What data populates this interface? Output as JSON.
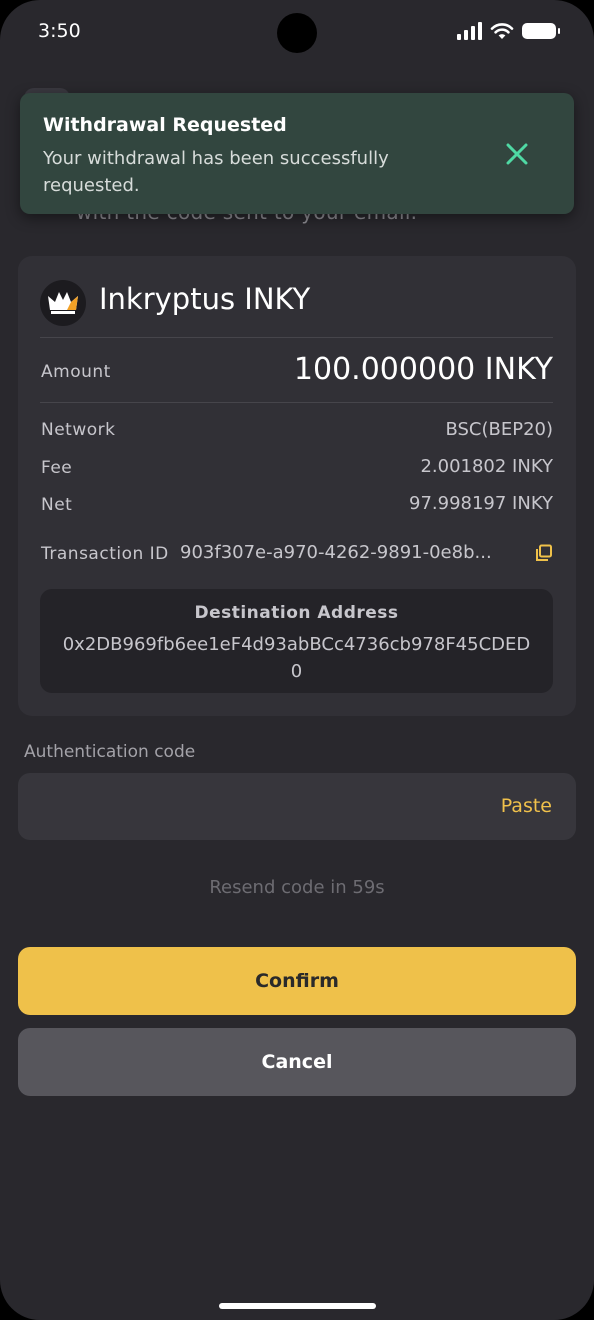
{
  "status_bar": {
    "time": "3:50"
  },
  "background": {
    "subtitle": "with the code sent to your email."
  },
  "toast": {
    "title": "Withdrawal Requested",
    "message": "Your withdrawal has been successfully requested.",
    "accent_color": "#4fd9a4"
  },
  "token": {
    "name": "Inkryptus INKY",
    "icon": "crown-logo-icon"
  },
  "details": {
    "amount_label": "Amount",
    "amount_value": "100.000000 INKY",
    "network_label": "Network",
    "network_value": "BSC(BEP20)",
    "fee_label": "Fee",
    "fee_value": "2.001802 INKY",
    "net_label": "Net",
    "net_value": "97.998197 INKY",
    "txid_label": "Transaction ID",
    "txid_value": "903f307e-a970-4262-9891-0e8b...",
    "destination_title": "Destination Address",
    "destination_address": "0x2DB969fb6ee1eF4d93abBCc4736cb978F45CDED0"
  },
  "auth": {
    "label": "Authentication code",
    "placeholder": "",
    "paste_label": "Paste",
    "resend_text": "Resend code in 59s"
  },
  "buttons": {
    "confirm": "Confirm",
    "cancel": "Cancel"
  },
  "colors": {
    "primary": "#efc14a",
    "background": "#29282d",
    "toast_bg": "#32463f"
  }
}
